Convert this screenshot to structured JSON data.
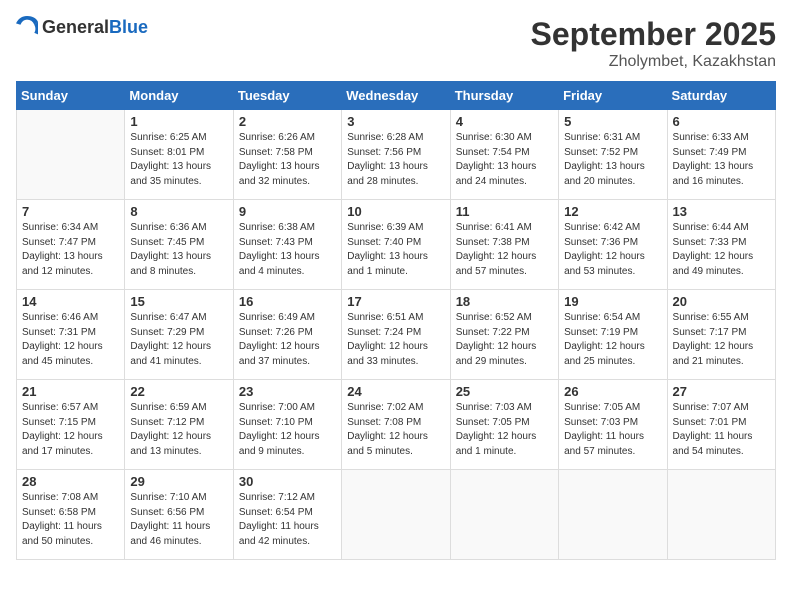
{
  "logo": {
    "general": "General",
    "blue": "Blue"
  },
  "header": {
    "month": "September 2025",
    "location": "Zholymbet, Kazakhstan"
  },
  "weekdays": [
    "Sunday",
    "Monday",
    "Tuesday",
    "Wednesday",
    "Thursday",
    "Friday",
    "Saturday"
  ],
  "weeks": [
    [
      {
        "day": "",
        "sunrise": "",
        "sunset": "",
        "daylight": ""
      },
      {
        "day": "1",
        "sunrise": "Sunrise: 6:25 AM",
        "sunset": "Sunset: 8:01 PM",
        "daylight": "Daylight: 13 hours and 35 minutes."
      },
      {
        "day": "2",
        "sunrise": "Sunrise: 6:26 AM",
        "sunset": "Sunset: 7:58 PM",
        "daylight": "Daylight: 13 hours and 32 minutes."
      },
      {
        "day": "3",
        "sunrise": "Sunrise: 6:28 AM",
        "sunset": "Sunset: 7:56 PM",
        "daylight": "Daylight: 13 hours and 28 minutes."
      },
      {
        "day": "4",
        "sunrise": "Sunrise: 6:30 AM",
        "sunset": "Sunset: 7:54 PM",
        "daylight": "Daylight: 13 hours and 24 minutes."
      },
      {
        "day": "5",
        "sunrise": "Sunrise: 6:31 AM",
        "sunset": "Sunset: 7:52 PM",
        "daylight": "Daylight: 13 hours and 20 minutes."
      },
      {
        "day": "6",
        "sunrise": "Sunrise: 6:33 AM",
        "sunset": "Sunset: 7:49 PM",
        "daylight": "Daylight: 13 hours and 16 minutes."
      }
    ],
    [
      {
        "day": "7",
        "sunrise": "Sunrise: 6:34 AM",
        "sunset": "Sunset: 7:47 PM",
        "daylight": "Daylight: 13 hours and 12 minutes."
      },
      {
        "day": "8",
        "sunrise": "Sunrise: 6:36 AM",
        "sunset": "Sunset: 7:45 PM",
        "daylight": "Daylight: 13 hours and 8 minutes."
      },
      {
        "day": "9",
        "sunrise": "Sunrise: 6:38 AM",
        "sunset": "Sunset: 7:43 PM",
        "daylight": "Daylight: 13 hours and 4 minutes."
      },
      {
        "day": "10",
        "sunrise": "Sunrise: 6:39 AM",
        "sunset": "Sunset: 7:40 PM",
        "daylight": "Daylight: 13 hours and 1 minute."
      },
      {
        "day": "11",
        "sunrise": "Sunrise: 6:41 AM",
        "sunset": "Sunset: 7:38 PM",
        "daylight": "Daylight: 12 hours and 57 minutes."
      },
      {
        "day": "12",
        "sunrise": "Sunrise: 6:42 AM",
        "sunset": "Sunset: 7:36 PM",
        "daylight": "Daylight: 12 hours and 53 minutes."
      },
      {
        "day": "13",
        "sunrise": "Sunrise: 6:44 AM",
        "sunset": "Sunset: 7:33 PM",
        "daylight": "Daylight: 12 hours and 49 minutes."
      }
    ],
    [
      {
        "day": "14",
        "sunrise": "Sunrise: 6:46 AM",
        "sunset": "Sunset: 7:31 PM",
        "daylight": "Daylight: 12 hours and 45 minutes."
      },
      {
        "day": "15",
        "sunrise": "Sunrise: 6:47 AM",
        "sunset": "Sunset: 7:29 PM",
        "daylight": "Daylight: 12 hours and 41 minutes."
      },
      {
        "day": "16",
        "sunrise": "Sunrise: 6:49 AM",
        "sunset": "Sunset: 7:26 PM",
        "daylight": "Daylight: 12 hours and 37 minutes."
      },
      {
        "day": "17",
        "sunrise": "Sunrise: 6:51 AM",
        "sunset": "Sunset: 7:24 PM",
        "daylight": "Daylight: 12 hours and 33 minutes."
      },
      {
        "day": "18",
        "sunrise": "Sunrise: 6:52 AM",
        "sunset": "Sunset: 7:22 PM",
        "daylight": "Daylight: 12 hours and 29 minutes."
      },
      {
        "day": "19",
        "sunrise": "Sunrise: 6:54 AM",
        "sunset": "Sunset: 7:19 PM",
        "daylight": "Daylight: 12 hours and 25 minutes."
      },
      {
        "day": "20",
        "sunrise": "Sunrise: 6:55 AM",
        "sunset": "Sunset: 7:17 PM",
        "daylight": "Daylight: 12 hours and 21 minutes."
      }
    ],
    [
      {
        "day": "21",
        "sunrise": "Sunrise: 6:57 AM",
        "sunset": "Sunset: 7:15 PM",
        "daylight": "Daylight: 12 hours and 17 minutes."
      },
      {
        "day": "22",
        "sunrise": "Sunrise: 6:59 AM",
        "sunset": "Sunset: 7:12 PM",
        "daylight": "Daylight: 12 hours and 13 minutes."
      },
      {
        "day": "23",
        "sunrise": "Sunrise: 7:00 AM",
        "sunset": "Sunset: 7:10 PM",
        "daylight": "Daylight: 12 hours and 9 minutes."
      },
      {
        "day": "24",
        "sunrise": "Sunrise: 7:02 AM",
        "sunset": "Sunset: 7:08 PM",
        "daylight": "Daylight: 12 hours and 5 minutes."
      },
      {
        "day": "25",
        "sunrise": "Sunrise: 7:03 AM",
        "sunset": "Sunset: 7:05 PM",
        "daylight": "Daylight: 12 hours and 1 minute."
      },
      {
        "day": "26",
        "sunrise": "Sunrise: 7:05 AM",
        "sunset": "Sunset: 7:03 PM",
        "daylight": "Daylight: 11 hours and 57 minutes."
      },
      {
        "day": "27",
        "sunrise": "Sunrise: 7:07 AM",
        "sunset": "Sunset: 7:01 PM",
        "daylight": "Daylight: 11 hours and 54 minutes."
      }
    ],
    [
      {
        "day": "28",
        "sunrise": "Sunrise: 7:08 AM",
        "sunset": "Sunset: 6:58 PM",
        "daylight": "Daylight: 11 hours and 50 minutes."
      },
      {
        "day": "29",
        "sunrise": "Sunrise: 7:10 AM",
        "sunset": "Sunset: 6:56 PM",
        "daylight": "Daylight: 11 hours and 46 minutes."
      },
      {
        "day": "30",
        "sunrise": "Sunrise: 7:12 AM",
        "sunset": "Sunset: 6:54 PM",
        "daylight": "Daylight: 11 hours and 42 minutes."
      },
      {
        "day": "",
        "sunrise": "",
        "sunset": "",
        "daylight": ""
      },
      {
        "day": "",
        "sunrise": "",
        "sunset": "",
        "daylight": ""
      },
      {
        "day": "",
        "sunrise": "",
        "sunset": "",
        "daylight": ""
      },
      {
        "day": "",
        "sunrise": "",
        "sunset": "",
        "daylight": ""
      }
    ]
  ]
}
